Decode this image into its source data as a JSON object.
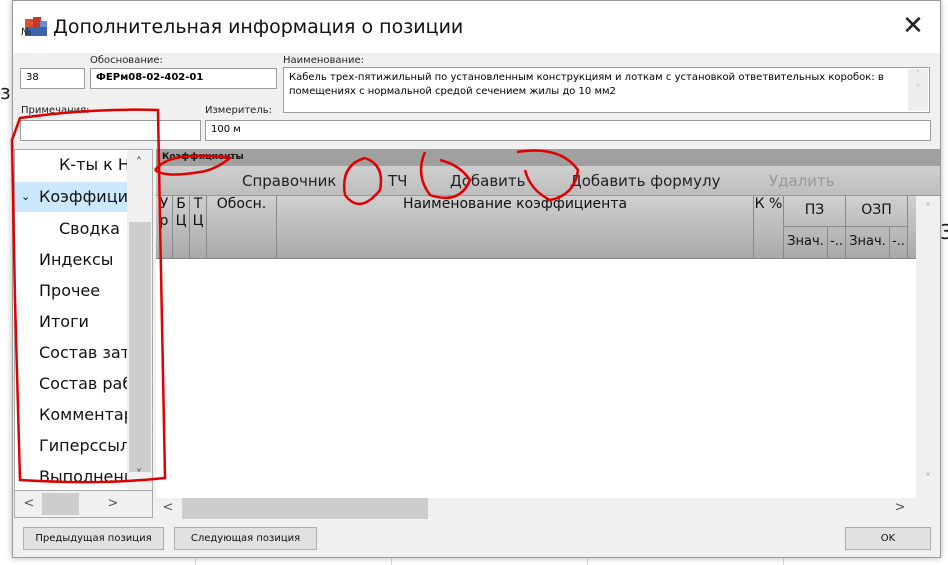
{
  "dialog": {
    "title": "Дополнительная информация о позиции",
    "close_label": "✕"
  },
  "fields": {
    "number_label": "№",
    "number_value": "38",
    "basis_label": "Обоснование:",
    "basis_value": "ФЕРм08-02-402-01",
    "name_label": "Наименование:",
    "name_value": "Кабель трех-пятижильный по установленным конструкциям и лоткам с установкой ответвительных коробок: в помещениях с нормальной средой сечением жилы до 10 мм2",
    "notes_label": "Примечания:",
    "notes_value": "",
    "unit_label": "Измеритель:",
    "unit_value": "100 м"
  },
  "tree": {
    "items": [
      {
        "label": "К-ты к Н"
      },
      {
        "label": "Коэффицие",
        "expanded": true,
        "selected": true
      },
      {
        "label": "Сводка"
      },
      {
        "label": "Индексы"
      },
      {
        "label": "Прочее"
      },
      {
        "label": "Итоги"
      },
      {
        "label": "Состав зат"
      },
      {
        "label": "Состав раб"
      },
      {
        "label": "Комментар"
      },
      {
        "label": "Гиперссыл"
      },
      {
        "label": "Выполнени"
      }
    ]
  },
  "coefficients": {
    "panel_title": "Коэффициенты",
    "toolbar": [
      "Справочник",
      "ТЧ",
      "Добавить",
      "Добавить формулу",
      "Удалить"
    ],
    "columns": {
      "ur": "У р",
      "bc": "Б Ц",
      "tc": "Т Ц",
      "basis": "Обосн.",
      "name": "Наименование коэффициента",
      "kpct": "К %",
      "pz": "ПЗ",
      "ozp": "ОЗП",
      "val": "Знач.",
      "dash": "-.."
    }
  },
  "buttons": {
    "prev": "Предыдущая позиция",
    "next": "Следующая позиция",
    "ok": "OK"
  },
  "colors": {
    "selection": "#cce8ff",
    "annotation": "#e00000"
  }
}
